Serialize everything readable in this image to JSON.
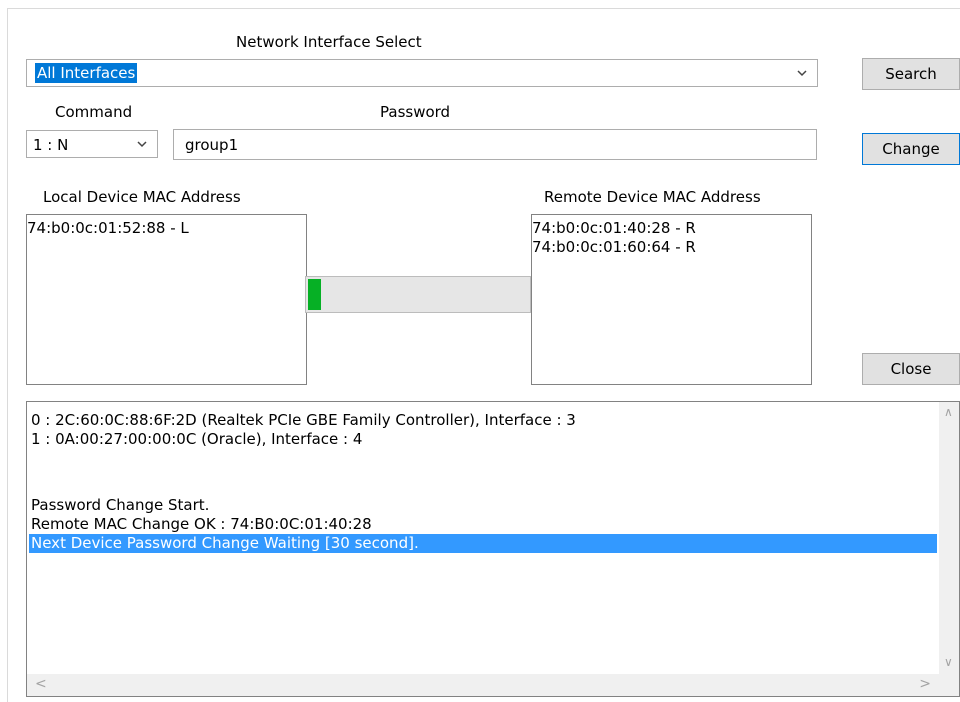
{
  "interface_select": {
    "label": "Network Interface Select",
    "selected": "All Interfaces"
  },
  "buttons": {
    "search": "Search",
    "change": "Change",
    "close": "Close"
  },
  "command": {
    "label": "Command",
    "selected": "1 : N"
  },
  "password": {
    "label": "Password",
    "value": "group1"
  },
  "local_device": {
    "label": "Local Device MAC Address",
    "items": [
      "74:b0:0c:01:52:88 - L"
    ]
  },
  "remote_device": {
    "label": "Remote Device MAC Address",
    "items": [
      "74:b0:0c:01:40:28 - R",
      "74:b0:0c:01:60:64 - R"
    ]
  },
  "progress": {
    "percent": 6,
    "color": "#06b025"
  },
  "log": {
    "lines": [
      "0 : 2C:60:0C:88:6F:2D (Realtek PCIe GBE Family Controller), Interface : 3",
      "1 : 0A:00:27:00:00:0C (Oracle), Interface : 4",
      "",
      "",
      "Password Change Start.",
      "Remote MAC Change OK : 74:B0:0C:01:40:28",
      "Next Device Password Change Waiting [30 second]."
    ],
    "highlighted_index": 6
  },
  "colors": {
    "selection": "#0078d7",
    "log_highlight": "#3399ff"
  }
}
